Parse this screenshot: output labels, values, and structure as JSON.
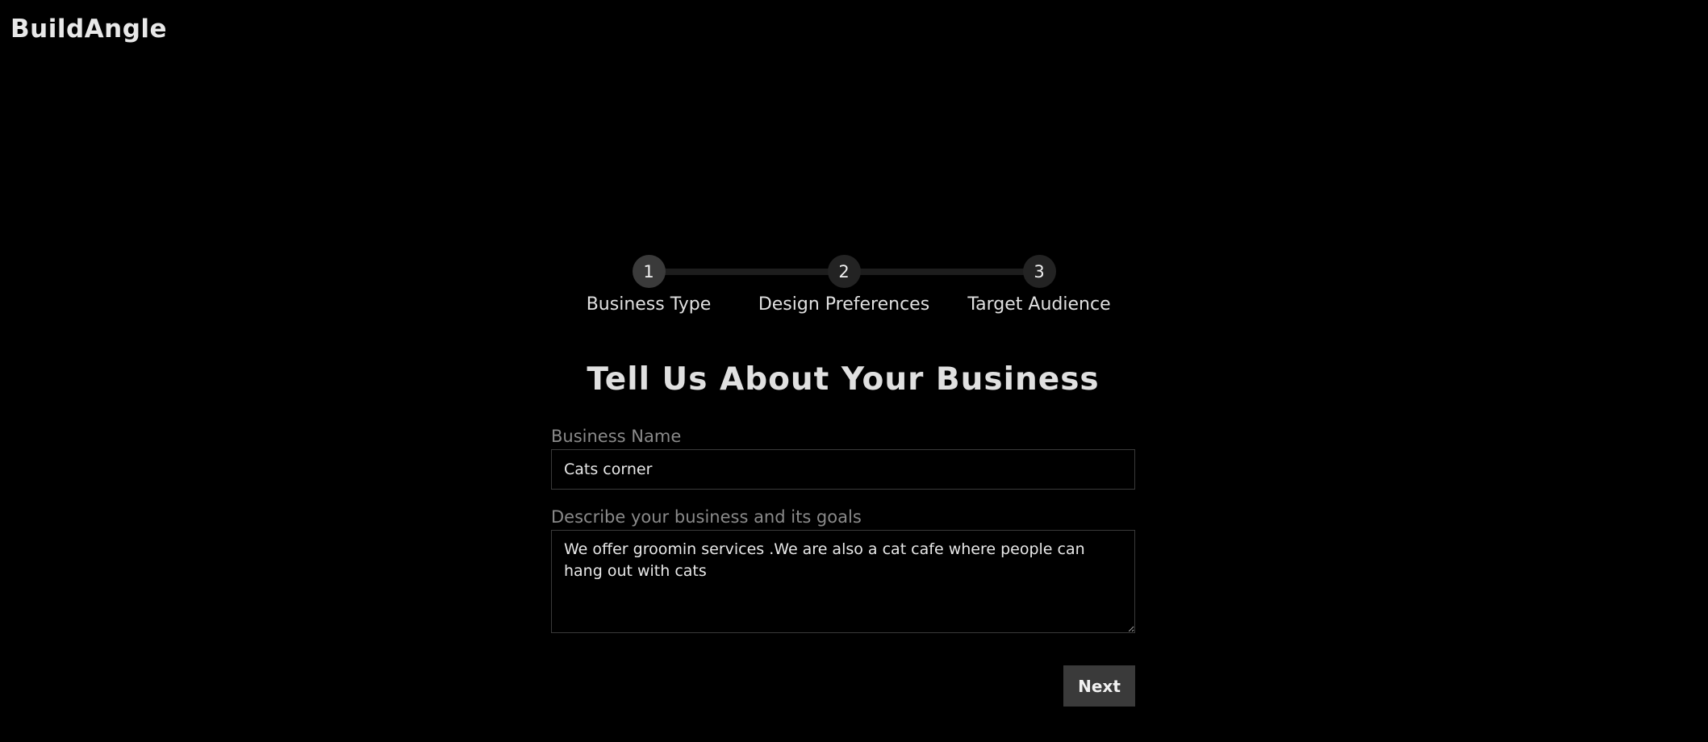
{
  "app": {
    "logo": "BuildAngle"
  },
  "stepper": {
    "steps": [
      {
        "number": "1",
        "label": "Business Type"
      },
      {
        "number": "2",
        "label": "Design Preferences"
      },
      {
        "number": "3",
        "label": "Target Audience"
      }
    ],
    "current_step": 1
  },
  "form": {
    "title": "Tell Us About Your Business",
    "business_name": {
      "label": "Business Name",
      "value": "Cats corner"
    },
    "description": {
      "label": "Describe your business and its goals",
      "value": "We offer groomin services .We are also a cat cafe where people can hang out with cats"
    },
    "next_label": "Next"
  },
  "colors": {
    "background": "#000000",
    "active_step": "#3a3a3a",
    "step_line": "#1d1d1d",
    "button": "#3a3a3a",
    "label_text": "#8a8a8a"
  }
}
